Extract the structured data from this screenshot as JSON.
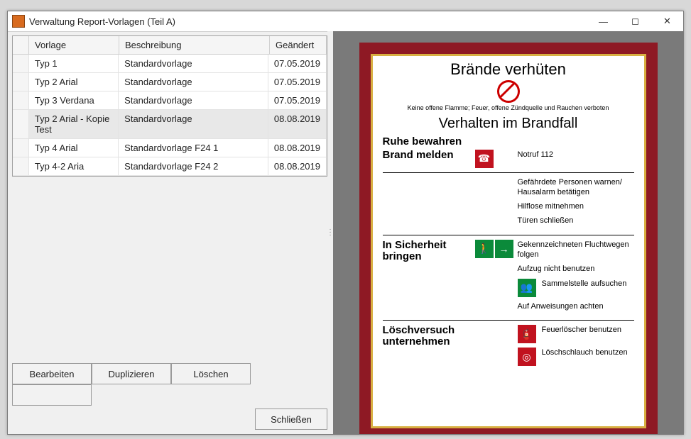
{
  "window": {
    "title": "Verwaltung Report-Vorlagen (Teil A)"
  },
  "grid": {
    "headers": {
      "vorlage": "Vorlage",
      "beschreibung": "Beschreibung",
      "geaendert": "Geändert"
    },
    "rows": [
      {
        "vorlage": "Typ 1",
        "beschreibung": "Standardvorlage",
        "geaendert": "07.05.2019"
      },
      {
        "vorlage": "Typ 2 Arial",
        "beschreibung": "Standardvorlage",
        "geaendert": "07.05.2019"
      },
      {
        "vorlage": "Typ 3 Verdana",
        "beschreibung": "Standardvorlage",
        "geaendert": "07.05.2019"
      },
      {
        "vorlage": "Typ 2 Arial - Kopie Test",
        "beschreibung": "Standardvorlage",
        "geaendert": "08.08.2019",
        "selected": true
      },
      {
        "vorlage": "Typ 4 Arial",
        "beschreibung": "Standardvorlage F24 1",
        "geaendert": "08.08.2019"
      },
      {
        "vorlage": "Typ 4-2 Aria",
        "beschreibung": "Standardvorlage F24 2",
        "geaendert": "08.08.2019"
      }
    ]
  },
  "buttons": {
    "edit": "Bearbeiten",
    "duplicate": "Duplizieren",
    "delete": "Löschen",
    "close": "Schließen"
  },
  "poster": {
    "title1": "Brände verhüten",
    "subtext": "Keine offene Flamme; Feuer, offene Zündquelle und Rauchen verboten",
    "title2": "Verhalten im Brandfall",
    "sec1": {
      "head": "Ruhe bewahren"
    },
    "sec2": {
      "head": "Brand melden",
      "text": "Notruf 112"
    },
    "sec3": {
      "l1": "Gefährdete Personen warnen/ Hausalarm betätigen",
      "l2": "Hilflose mitnehmen",
      "l3": "Türen schließen"
    },
    "sec4": {
      "head": "In Sicherheit bringen",
      "l1": "Gekennzeichneten Fluchtwegen folgen",
      "l2": "Aufzug nicht benutzen",
      "l3": "Sammelstelle aufsuchen",
      "l4": "Auf Anweisungen achten"
    },
    "sec5": {
      "head": "Löschversuch unternehmen",
      "l1": "Feuerlöscher benutzen",
      "l2": "Löschschlauch benutzen"
    }
  }
}
